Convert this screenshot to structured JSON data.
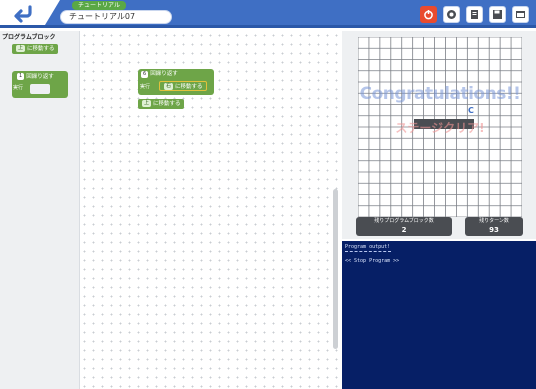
{
  "header": {
    "breadcrumb_label": "チュートリアル",
    "title": "チュートリアル07",
    "buttons": [
      "stop-icon",
      "record-icon",
      "document-icon",
      "save-icon",
      "window-icon"
    ],
    "colors": {
      "bar": "#3f6fc4",
      "accent": "#5aa845",
      "stop": "#e94b2e"
    }
  },
  "palette": {
    "title": "プログラムブロック",
    "move_block": {
      "dir": "上",
      "label": "に移動する"
    },
    "repeat_block": {
      "count": "1",
      "label": "回繰り返す",
      "exec": "実行"
    }
  },
  "workspace": {
    "repeat": {
      "count": "6",
      "label": "回繰り返す",
      "exec": "実行"
    },
    "inner_move": {
      "dir": "右",
      "label": "に移動する"
    },
    "after_move": {
      "dir": "上",
      "label": "に移動する"
    }
  },
  "grid_panel": {
    "congrats_text": "Congratulations!!",
    "clear_text": "ステージクリア!",
    "marker": "C",
    "columns": 15,
    "rows": 16,
    "stats": [
      {
        "label": "残りプログラムブロック数",
        "value": "2"
      },
      {
        "label": "残りターン数",
        "value": "93"
      }
    ]
  },
  "output": {
    "title": "Program output!",
    "line": "<< Stop Program >>"
  },
  "zoom": {
    "center": "◎",
    "zoom_in": "+",
    "zoom_out": "−"
  }
}
